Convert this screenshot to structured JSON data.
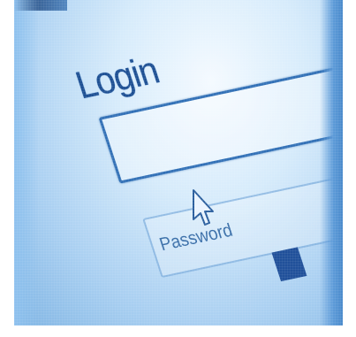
{
  "login": {
    "title": "Login",
    "username_value": ""
  },
  "password": {
    "label": "Password"
  },
  "colors": {
    "accent": "#1d4f93",
    "field_border": "#3170b6",
    "background": "#cfe6fa"
  },
  "icons": {
    "cursor": "mouse-pointer-icon"
  }
}
